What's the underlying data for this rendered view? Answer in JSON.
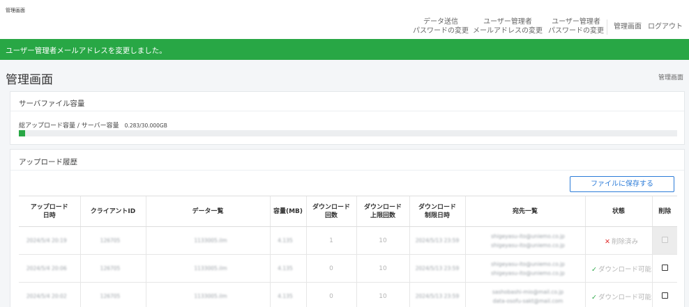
{
  "window": {
    "title": "管理画面"
  },
  "nav": {
    "items": [
      {
        "line1": "データ送信",
        "line2": "パスワードの変更"
      },
      {
        "line1": "ユーザー管理者",
        "line2": "メールアドレスの変更"
      },
      {
        "line1": "ユーザー管理者",
        "line2": "パスワードの変更"
      },
      {
        "line1": "管理画面",
        "line2": ""
      },
      {
        "line1": "ログアウト",
        "line2": ""
      }
    ]
  },
  "alert": {
    "message": "ユーザー管理者メールアドレスを変更しました。",
    "color": "#28a745"
  },
  "page": {
    "title": "管理画面",
    "breadcrumb": "管理画面"
  },
  "capacity": {
    "title": "サーバファイル容量",
    "label": "総アップロード容量 / サーバー容量",
    "value": "0.283/30.000GB",
    "used_fraction": 0.0094
  },
  "history": {
    "title": "アップロード履歴",
    "save_button": "ファイルに保存する",
    "headers": {
      "datetime": [
        "アップロード",
        "日時"
      ],
      "client_id": "クライアントID",
      "data_list": "データ一覧",
      "size": "容量(MB)",
      "dl_count": [
        "ダウンロード",
        "回数"
      ],
      "dl_limit": [
        "ダウンロード",
        "上限回数"
      ],
      "dl_deadline": [
        "ダウンロード",
        "制限日時"
      ],
      "recipients": "宛先一覧",
      "status": "状態",
      "delete": "削除"
    },
    "rows": [
      {
        "datetime": "2024/5/4 20:19",
        "client_id": "126705",
        "data": "1133005.ilm",
        "size": "4.135",
        "dl_count": "1",
        "dl_limit": "10",
        "deadline": "2024/5/13 23:59",
        "recipients": [
          "shigeyasu-ito@uniemo.co.jp",
          "shigeyasu-ito@uniemo.co.jp"
        ],
        "status": "削除済み",
        "status_type": "deleted"
      },
      {
        "datetime": "2024/5/4 20:06",
        "client_id": "126705",
        "data": "1133005.ilm",
        "size": "4.135",
        "dl_count": "0",
        "dl_limit": "10",
        "deadline": "2024/5/13 23:59",
        "recipients": [
          "shigeyasu-ito@uniemo.co.jp",
          "shigeyasu-ito@uniemo.co.jp"
        ],
        "status": "ダウンロード可能",
        "status_type": "available"
      },
      {
        "datetime": "2024/5/4 20:02",
        "client_id": "126705",
        "data": "1133005.ilm",
        "size": "4.135",
        "dl_count": "0",
        "dl_limit": "10",
        "deadline": "2024/5/13 23:59",
        "recipients": [
          "sashobashi-mio@mail.co.jp",
          "data-osofu-sakt@mail.com"
        ],
        "status": "ダウンロード可能",
        "status_type": "available"
      }
    ]
  }
}
